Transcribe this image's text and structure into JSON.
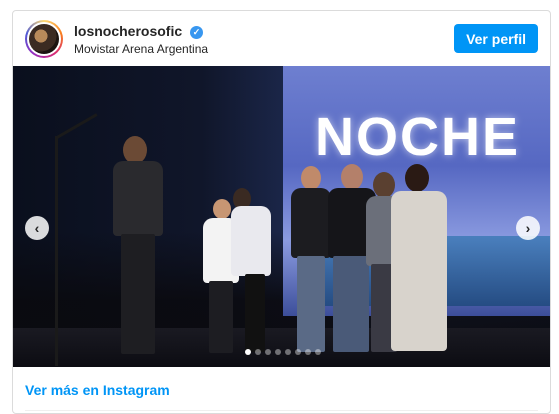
{
  "header": {
    "username": "losnocherosofic",
    "verified_icon": "verified-badge-icon",
    "location": "Movistar Arena Argentina",
    "profile_button": "Ver perfil"
  },
  "media": {
    "screen_text": "NOCHE",
    "carousel": {
      "prev_icon": "chevron-left-icon",
      "next_icon": "chevron-right-icon",
      "prev_glyph": "‹",
      "next_glyph": "›",
      "dot_count": 8,
      "active_index": 0
    }
  },
  "footer": {
    "link_text": "Ver más en Instagram"
  },
  "colors": {
    "accent": "#0095f6",
    "verified": "#3897f0"
  }
}
